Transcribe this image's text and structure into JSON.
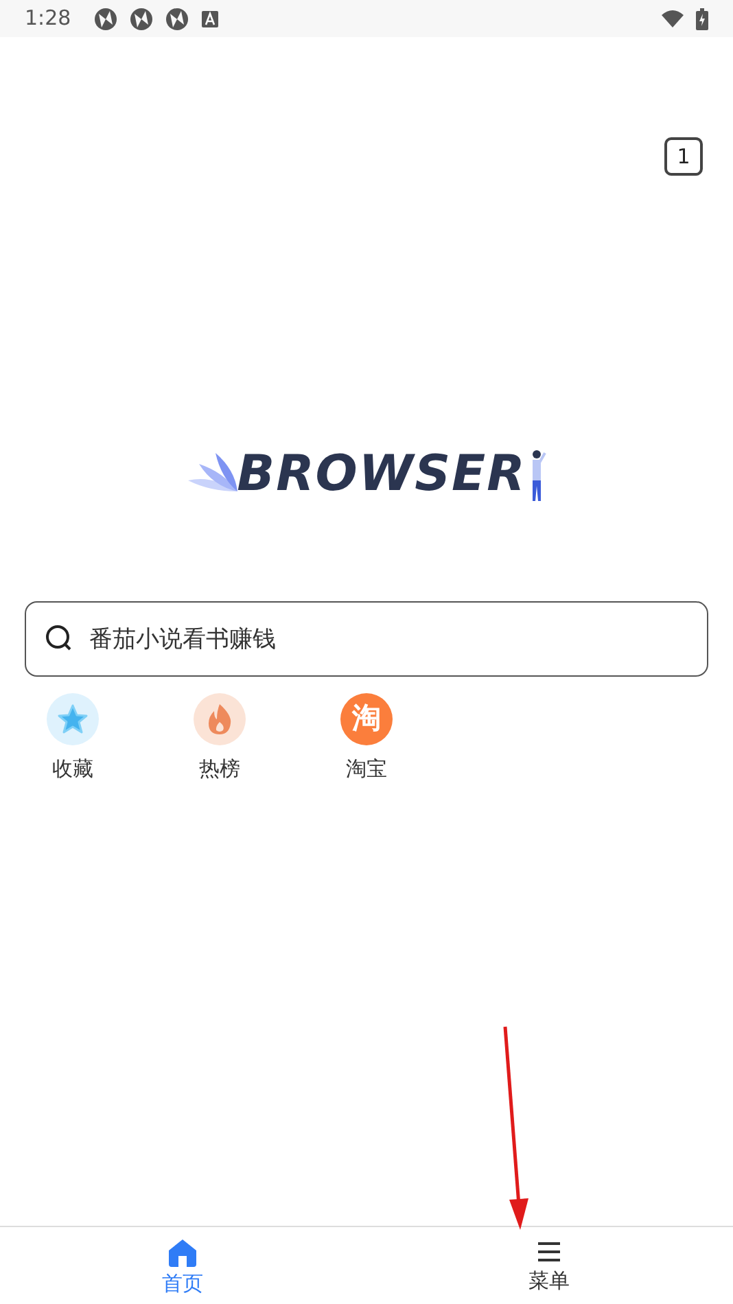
{
  "status_bar": {
    "time": "1:28"
  },
  "tab_count": "1",
  "logo": {
    "text": "BROWSER"
  },
  "search": {
    "placeholder": "番茄小说看书赚钱"
  },
  "shortcuts": [
    {
      "kind": "star",
      "label": "收藏"
    },
    {
      "kind": "fire",
      "label": "热榜"
    },
    {
      "kind": "taobao",
      "label": "淘宝",
      "glyph": "淘"
    }
  ],
  "bottom_nav": [
    {
      "kind": "home",
      "label": "首页",
      "selected": true
    },
    {
      "kind": "menu",
      "label": "菜单",
      "selected": false
    }
  ]
}
